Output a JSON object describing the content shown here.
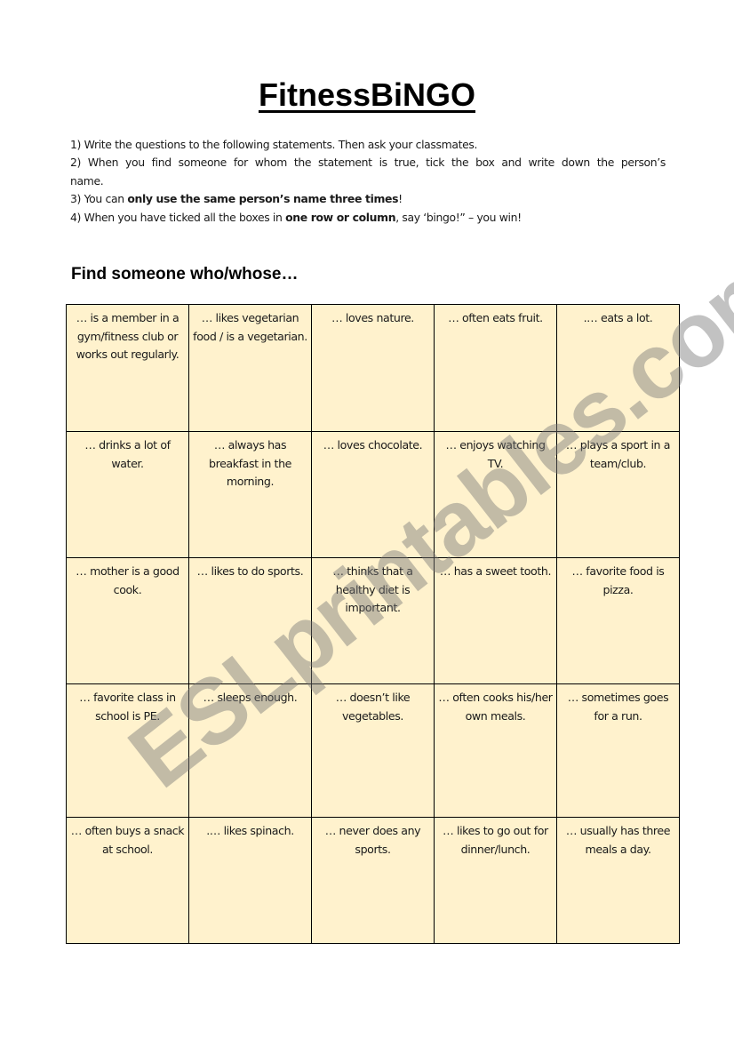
{
  "title": "FitnessBiNGO",
  "instructions": [
    {
      "parts": [
        {
          "text": "1) Write the questions to the following statements. Then ask your classmates.",
          "bold": false
        }
      ]
    },
    {
      "parts": [
        {
          "text": "2) When you find someone for whom the statement is true, tick the box and write down the person’s name.",
          "bold": false
        }
      ]
    },
    {
      "parts": [
        {
          "text": "3) You can ",
          "bold": false
        },
        {
          "text": "only use the same person’s name three times",
          "bold": true
        },
        {
          "text": "!",
          "bold": false
        }
      ]
    },
    {
      "parts": [
        {
          "text": "4) When you have ticked all the boxes in ",
          "bold": false
        },
        {
          "text": "one row or column",
          "bold": true
        },
        {
          "text": ", say ‘bingo!” – you win!",
          "bold": false
        }
      ]
    }
  ],
  "subtitle": "Find someone who/whose…",
  "grid": {
    "rows": [
      [
        "… is a member in a gym/fitness club or works out regularly.",
        "… likes vegetarian food / is a vegetarian.",
        "… loves nature.",
        "… often eats fruit.",
        ".… eats a lot."
      ],
      [
        "… drinks a lot of water.",
        "… always has breakfast in the morning.",
        "… loves chocolate.",
        "… enjoys watching TV.",
        "… plays a sport in a team/club."
      ],
      [
        "… mother is a good cook.",
        "… likes to do sports.",
        "… thinks that a healthy diet is important.",
        "… has a sweet tooth.",
        "… favorite food is pizza."
      ],
      [
        "… favorite class in school is PE.",
        "… sleeps enough.",
        "… doesn’t like vegetables.",
        "… often cooks his/her own meals.",
        "… sometimes goes for a run."
      ],
      [
        "… often buys a snack at school.",
        ".… likes spinach.",
        "… never does any sports.",
        "… likes to go out for dinner/lunch.",
        "… usually has three meals a day."
      ]
    ]
  },
  "watermark": "ESLprintables.com",
  "colors": {
    "cell_fill": "#fff2cd",
    "border": "#000000",
    "watermark": "#787878"
  }
}
